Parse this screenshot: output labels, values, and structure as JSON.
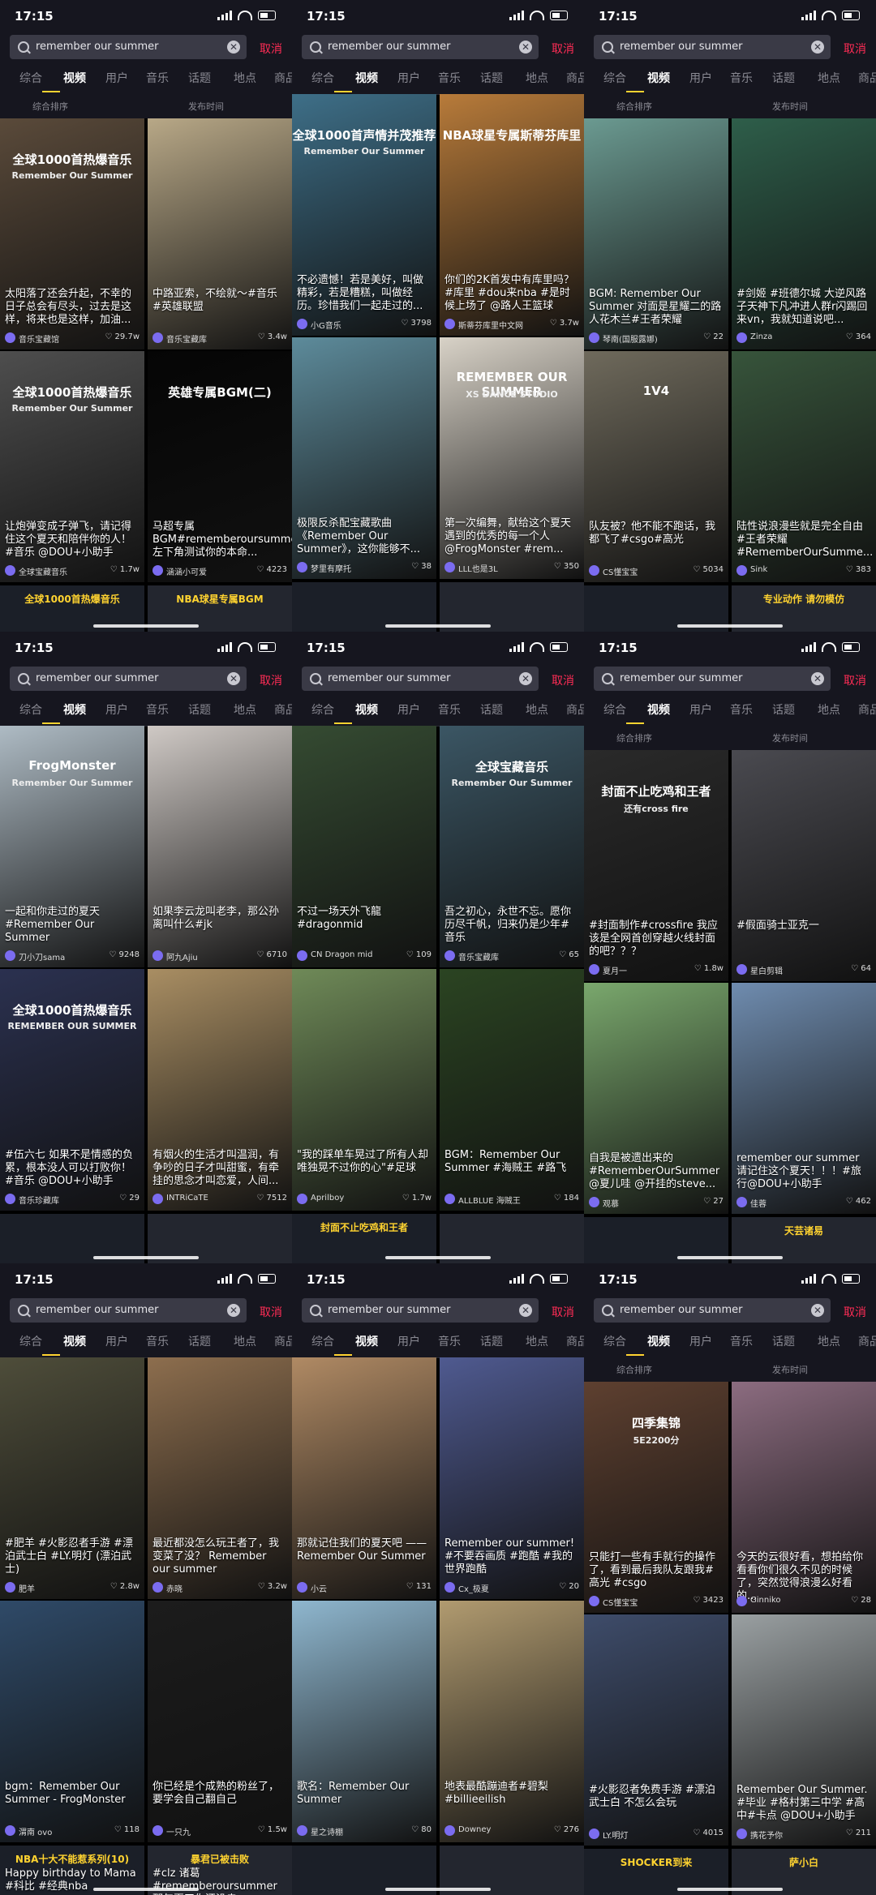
{
  "status": {
    "time": "17:15"
  },
  "search": {
    "value": "remember our summer",
    "clear": "✕",
    "cancel": "取消"
  },
  "tabs": [
    "综合",
    "视频",
    "用户",
    "音乐",
    "话题",
    "地点",
    "商品"
  ],
  "sort": {
    "left": "综合排序",
    "right": "发布时间"
  },
  "icons": {
    "search": "search-icon",
    "clear": "close-icon",
    "like": "heart-icon",
    "signal": "signal-icon",
    "wifi": "wifi-icon",
    "battery": "battery-icon"
  },
  "panels": [
    {
      "cards": [
        {
          "bg": "#5a4a3a",
          "title": "全球1000首热爆音乐",
          "sub": "Remember Our Summer",
          "cap": "太阳落了还会升起，不幸的日子总会有尽头，过去是这样，将来也是这样，加油...",
          "author": "音乐宝藏馆",
          "likes": "29.7w"
        },
        {
          "bg": "#b8a887",
          "title": "",
          "sub": "",
          "cap": "中路亚索，不绘就～#音乐 #英雄联盟",
          "author": "音乐宝藏库",
          "likes": "3.4w"
        },
        {
          "bg": "#4e4e4e",
          "title": "全球1000首热爆音乐",
          "sub": "Remember Our Summer",
          "cap": "让炮弹变成子弹飞，请记得住这个夏天和陪伴你的人！#音乐 @DOU+小助手",
          "author": "全球宝藏音乐",
          "likes": "1.7w"
        },
        {
          "bg": "#050505",
          "title": "英雄专属BGM(二)",
          "sub": "",
          "cap": "马超专属BGM#rememberoursummer 左下角测试你的本命...",
          "author": "涵涵小可爱",
          "likes": "4223"
        }
      ],
      "bottom": [
        "全球1000首热爆音乐",
        "NBA球星专属BGM"
      ]
    },
    {
      "cards": [
        {
          "bg": "#3e6f88",
          "title": "全球1000首声情并茂推荐",
          "sub": "Remember Our Summer",
          "cap": "不必遗憾！若是美好，叫做精彩，若是糟糕，叫做经历。珍惜我们一起走过的...",
          "author": "小G音乐",
          "likes": "3798"
        },
        {
          "bg": "#b87b3a",
          "title": "NBA球星专属斯蒂芬库里",
          "sub": "",
          "cap": "你们的2K首发中有库里吗？#库里 #dou来nba #是时候上场了 @路人王篮球",
          "author": "斯蒂芬库里中文网",
          "likes": "3.7w"
        },
        {
          "bg": "#5d8b9b",
          "title": "",
          "sub": "",
          "cap": "极限反杀配宝藏歌曲《Remember Our Summer》，这你能够不...",
          "author": "梦里有摩托",
          "likes": "38"
        },
        {
          "bg": "#d8d2c7",
          "title": "REMEMBER OUR SUMMER",
          "sub": "XS DANCE STUDIO",
          "cap": "第一次编舞，献给这个夏天遇到的优秀的每一个人 @FrogMonster #rem...",
          "author": "LLL也是3L",
          "likes": "350"
        }
      ],
      "bottom": [
        "",
        ""
      ]
    },
    {
      "cards": [
        {
          "bg": "#6b9a91",
          "title": "",
          "sub": "",
          "cap": "BGM: Remember Our Summer 对面是星耀二的路人花木兰#王者荣耀",
          "author": "琴南(国服露娜)",
          "likes": "22"
        },
        {
          "bg": "#2e5e4a",
          "title": "",
          "sub": "",
          "cap": "#剑姬 #班德尔城 大逆风路子天神下凡冲进人群r闪踢回来vn，我就知道说吧...",
          "author": "Zinza",
          "likes": "364"
        },
        {
          "bg": "#6f6a5c",
          "title": "1V4",
          "sub": "",
          "cap": "队友被？他不能不跑话，我都飞了#csgo#高光",
          "author": "CS懂宝宝",
          "likes": "5034"
        },
        {
          "bg": "#37543b",
          "title": "",
          "sub": "",
          "cap": "陆性说浪漫些就是完全自由#王者荣耀 #RememberOurSumme...",
          "author": "Sink",
          "likes": "383"
        }
      ],
      "bottom": [
        "",
        "专业动作 请勿模仿"
      ]
    },
    {
      "cards": [
        {
          "bg": "#aebbc4",
          "title": "FrogMonster",
          "sub": "Remember Our Summer",
          "cap": "一起和你走过的夏天 #Remember Our Summer",
          "author": "刀小刀sama",
          "likes": "9248"
        },
        {
          "bg": "#cfc9c5",
          "title": "",
          "sub": "",
          "cap": "如果李云龙叫老李，那公孙离叫什么#jk",
          "author": "阿九Ajiu",
          "likes": "6710"
        },
        {
          "bg": "#2b3150",
          "title": "全球1000首热爆音乐",
          "sub": "REMEMBER OUR SUMMER",
          "cap": "#伍六七 如果不是情感的负累，根本没人可以打败你！#音乐 @DOU+小助手",
          "author": "音乐珍藏库",
          "likes": "29"
        },
        {
          "bg": "#a98e63",
          "title": "",
          "sub": "",
          "cap": "有烟火的生活才叫温润，有争吵的日子才叫甜蜜，有牵挂的思念才叫恋爱，人间...",
          "author": "INTRiCaTE",
          "likes": "7512"
        }
      ],
      "bottom": [
        "",
        ""
      ]
    },
    {
      "cards": [
        {
          "bg": "#354b32",
          "title": "",
          "sub": "",
          "cap": "不过一场天外飞龍 #dragonmid",
          "author": "CN Dragon mid",
          "likes": "109"
        },
        {
          "bg": "#3b5664",
          "title": "全球宝藏音乐",
          "sub": "Remember Our Summer",
          "cap": "吾之初心，永世不忘。愿你历尽千帆，归来仍是少年#音乐",
          "author": "音乐宝藏库",
          "likes": "65"
        },
        {
          "bg": "#6f8a58",
          "title": "",
          "sub": "",
          "cap": "\"我的踩单车晃过了所有人却唯独晃不过你的心\"#足球",
          "author": "Aprilboy",
          "likes": "1.7w"
        },
        {
          "bg": "#2b4422",
          "title": "",
          "sub": "",
          "cap": "BGM：Remember Our Summer #海贼王 #路飞",
          "author": "ALLBLUE 海贼王",
          "likes": "184"
        }
      ],
      "bottom": [
        "封面不止吃鸡和王者",
        ""
      ]
    },
    {
      "cards": [
        {
          "bg": "#2a2a2a",
          "title": "封面不止吃鸡和王者",
          "sub": "还有cross fire",
          "cap": "#封面制作#crossfire 我应该是全网首创穿越火线封面的吧？？？",
          "author": "夏月一",
          "likes": "1.8w"
        },
        {
          "bg": "#4a4a50",
          "title": "",
          "sub": "",
          "cap": "#假面骑士亚克一",
          "author": "星白剪辑",
          "likes": "64"
        },
        {
          "bg": "#7aa86d",
          "title": "",
          "sub": "",
          "cap": "自我是被遗出来的 #RememberOurSummer @夏儿哇 @开挂的steve...",
          "author": "观慕",
          "likes": "27"
        },
        {
          "bg": "#6f8caf",
          "title": "",
          "sub": "",
          "cap": "remember our summer 请记住这个夏天！！！#旅行@DOU+小助手",
          "author": "佳蓉",
          "likes": "462"
        }
      ],
      "bottom": [
        "",
        "天芸诸易"
      ]
    },
    {
      "cards": [
        {
          "bg": "#4e4d3a",
          "title": "",
          "sub": "",
          "cap": "#肥羊 #火影忍者手游 #漂泊武士白 #LY.明灯 (漂泊武士)",
          "author": "肥羊",
          "likes": "2.8w"
        },
        {
          "bg": "#8d6e4e",
          "title": "",
          "sub": "",
          "cap": "最近都没怎么玩王者了，我变菜了没？ Remember our summer",
          "author": "赤晓",
          "likes": "3.2w"
        },
        {
          "bg": "#2f4a68",
          "title": "",
          "sub": "",
          "cap": "bgm：Remember Our Summer - FrogMonster",
          "author": "渭南 ovo",
          "likes": "118"
        },
        {
          "bg": "#1c1c1c",
          "title": "",
          "sub": "",
          "cap": "你已经是个成熟的粉丝了，要学会自己翻自己",
          "author": "一只九",
          "likes": "1.5w"
        }
      ],
      "bottom": [
        "NBA十大不能惹系列(10)",
        "暴君已被击败"
      ],
      "footer": [
        "Happy birthday to Mama #科比 #经典nba",
        "#clz 诸葛 #rememberoursummer 那年夏天你还没走"
      ]
    },
    {
      "cards": [
        {
          "bg": "#b08a64",
          "title": "",
          "sub": "",
          "cap": "那就记住我们的夏天吧 —— Remember Our Summer",
          "author": "小云",
          "likes": "131"
        },
        {
          "bg": "#4f5a90",
          "title": "",
          "sub": "",
          "cap": "Remember our summer! #不要吞画质 #跑酷 #我的世界跑酷",
          "author": "Cx_极夏",
          "likes": "20"
        },
        {
          "bg": "#8fb7cf",
          "title": "",
          "sub": "",
          "cap": "歌名：Remember Our Summer",
          "author": "星之诗棚",
          "likes": "80"
        },
        {
          "bg": "#b19b70",
          "title": "",
          "sub": "",
          "cap": "地表最酷蹦迪者#碧梨 #billieeilish",
          "author": "Downey",
          "likes": "276"
        }
      ],
      "bottom": [
        "",
        ""
      ]
    },
    {
      "cards": [
        {
          "bg": "#5e4030",
          "title": "四季集锦",
          "sub": "5E2200分",
          "cap": "只能打一些有手就行的操作了，看到最后我队友跟我#高光 #csgo",
          "author": "CS懂宝宝",
          "likes": "3423"
        },
        {
          "bg": "#8c6c80",
          "title": "",
          "sub": "",
          "cap": "今天的云很好看，想拍给你看看你们很久不见的时候了，突然觉得浪漫么好看的...",
          "author": "Ginniko",
          "likes": "28"
        },
        {
          "bg": "#3e4c6a",
          "title": "",
          "sub": "",
          "cap": "#火影忍者免费手游 #漂泊武士白 不怎么会玩",
          "author": "LY.明灯",
          "likes": "4015"
        },
        {
          "bg": "#9aa0a2",
          "title": "",
          "sub": "",
          "cap": "Remember Our Summer. #毕业 #格村第三中学 #高中#卡点 @DOU+小助手",
          "author": "携花予你",
          "likes": "211"
        }
      ],
      "bottom": [
        "SHOCKER到来",
        "萨小白"
      ]
    }
  ]
}
